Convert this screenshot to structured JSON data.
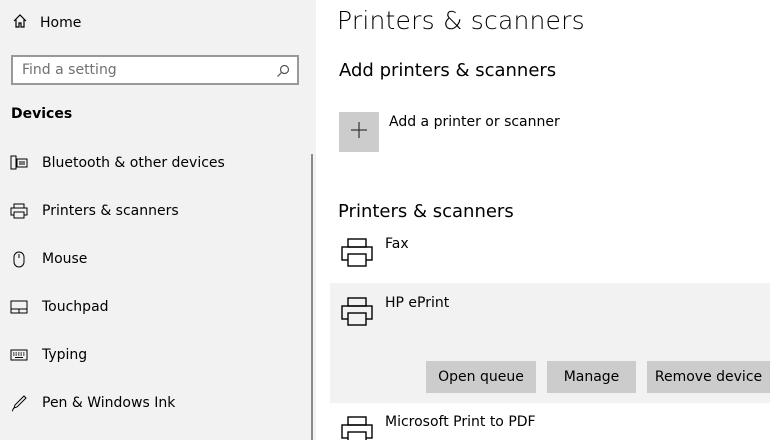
{
  "sidebar": {
    "home_label": "Home",
    "search": {
      "placeholder": "Find a setting"
    },
    "section_title": "Devices",
    "items": [
      {
        "label": "Bluetooth & other devices",
        "icon": "bluetooth-devices-icon"
      },
      {
        "label": "Printers & scanners",
        "icon": "printer-icon"
      },
      {
        "label": "Mouse",
        "icon": "mouse-icon"
      },
      {
        "label": "Touchpad",
        "icon": "touchpad-icon"
      },
      {
        "label": "Typing",
        "icon": "keyboard-icon"
      },
      {
        "label": "Pen & Windows Ink",
        "icon": "pen-icon"
      }
    ]
  },
  "main": {
    "title": "Printers & scanners",
    "add_section": {
      "heading": "Add printers & scanners",
      "add_label": "Add a printer or scanner"
    },
    "list_section": {
      "heading": "Printers & scanners",
      "printers": [
        {
          "name": "Fax"
        },
        {
          "name": "HP ePrint"
        },
        {
          "name": "Microsoft Print to PDF"
        }
      ],
      "actions": {
        "open_queue": "Open queue",
        "manage": "Manage",
        "remove": "Remove device"
      }
    }
  },
  "colors": {
    "sidebar_bg": "#f2f2f2",
    "button_bg": "#cccccc",
    "selected_bg": "#f2f2f2"
  }
}
